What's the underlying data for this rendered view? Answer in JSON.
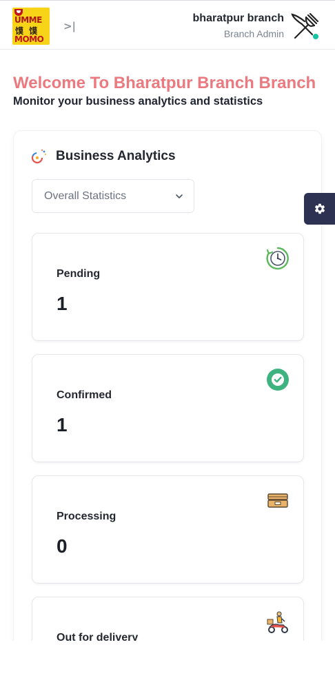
{
  "header": {
    "logo_text": [
      "UMME",
      "馍 馍",
      "MOMO"
    ],
    "collapse_icon": "sidebar-collapse-icon",
    "branch_name": "bharatpur branch",
    "role": "Branch Admin",
    "avatar_icon": "fork-knife-icon",
    "status_color": "#17c3a3"
  },
  "welcome": {
    "title": "Welcome To Bharatpur Branch Branch",
    "subtitle": "Monitor your business analytics and statistics",
    "title_color": "#ea7a7f"
  },
  "analytics": {
    "title": "Business Analytics",
    "icon": "analytics-icon",
    "filter": {
      "selected": "Overall Statistics"
    },
    "cards": [
      {
        "label": "Pending",
        "value": "1",
        "icon": "clock-icon"
      },
      {
        "label": "Confirmed",
        "value": "1",
        "icon": "check-circle-icon"
      },
      {
        "label": "Processing",
        "value": "0",
        "icon": "box-icon"
      },
      {
        "label": "Out for delivery",
        "value": "",
        "icon": "delivery-scooter-icon"
      }
    ]
  },
  "settings_fab": {
    "icon": "gear-icon",
    "color": "#2d3253"
  }
}
